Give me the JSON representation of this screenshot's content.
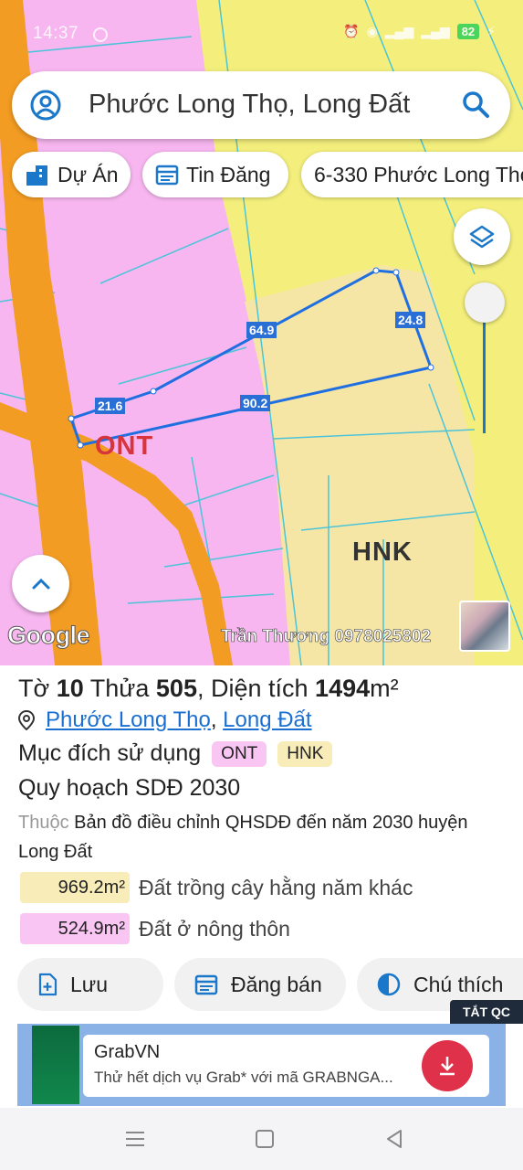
{
  "status": {
    "time": "14:37",
    "battery": "82"
  },
  "search": {
    "text": "Phước Long Thọ, Long Đất"
  },
  "chips": {
    "project": "Dự Án",
    "listing": "Tin Đăng",
    "address": "6-330 Phước Long Thọ"
  },
  "map": {
    "labels": {
      "ont": "ONT",
      "hnk": "HNK"
    },
    "dimensions": {
      "d1": "21.6",
      "d2": "64.9",
      "d3": "24.8",
      "d4": "90.2"
    },
    "google": "Google",
    "watermark": "Trần Thương 0978025802",
    "colors": {
      "residential": "#f7b6f0",
      "farmland": "#f6e6a6",
      "other": "#f4ef7c",
      "road": "#f39c23",
      "boundary": "#1f6fe0"
    }
  },
  "parcel": {
    "sheet_label": "Tờ",
    "sheet": "10",
    "plot_label": "Thửa",
    "plot": "505",
    "area_label": ", Diện tích",
    "area": "1494",
    "area_unit": "m²",
    "commune": "Phước Long Thọ",
    "district": "Long Đất",
    "purpose_label": "Mục đích sử dụng",
    "purpose_tags": [
      {
        "code": "ONT",
        "color": "#f9c6f3"
      },
      {
        "code": "HNK",
        "color": "#f8ecb8"
      }
    ],
    "plan_title": "Quy hoạch SDĐ 2030",
    "belongs_label": "Thuộc",
    "belongs_text": "Bản đồ điều chỉnh QHSDĐ đến năm 2030 huyện Long Đất",
    "areas": [
      {
        "value": "969.2m²",
        "desc": "Đất trồng cây hằng năm khác",
        "color": "#f8ecb8"
      },
      {
        "value": "524.9m²",
        "desc": "Đất ở nông thôn",
        "color": "#f9c6f3"
      }
    ]
  },
  "actions": {
    "save": "Lưu",
    "sell": "Đăng bán",
    "legend": "Chú thích"
  },
  "ad": {
    "close_label": "TẮT QC",
    "name": "GrabVN",
    "desc": "Thử hết dịch vụ Grab* với mã GRABNGA..."
  }
}
